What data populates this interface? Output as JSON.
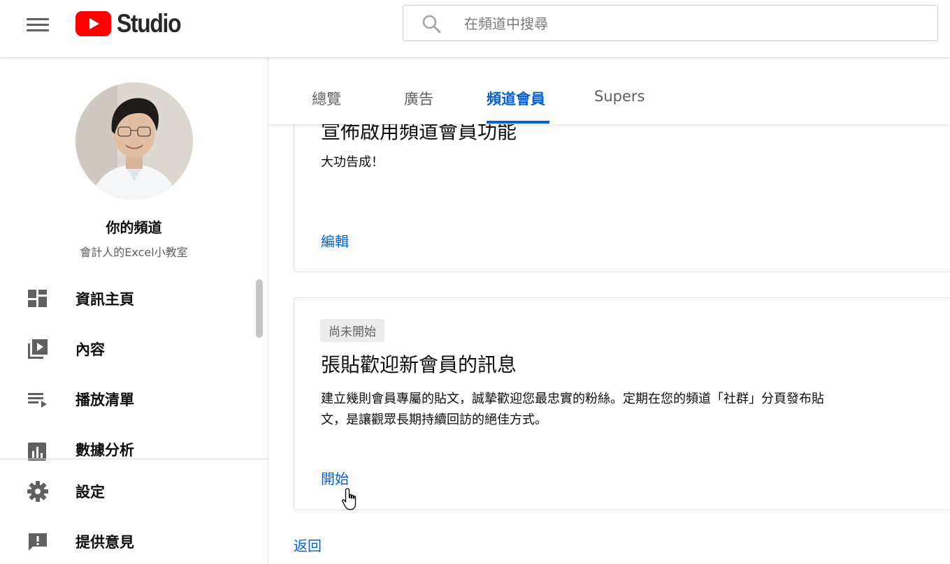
{
  "header": {
    "logo_text": "Studio",
    "search_placeholder": "在頻道中搜尋",
    "brand_color": "#ff0000"
  },
  "sidebar": {
    "channel_title": "你的頻道",
    "channel_name": "會計人的Excel小教室",
    "items": [
      {
        "label": "資訊主頁",
        "icon": "dashboard-icon"
      },
      {
        "label": "內容",
        "icon": "video-library-icon"
      },
      {
        "label": "播放清單",
        "icon": "playlist-icon"
      },
      {
        "label": "數據分析",
        "icon": "analytics-icon"
      }
    ],
    "bottom_items": [
      {
        "label": "設定",
        "icon": "gear-icon"
      },
      {
        "label": "提供意見",
        "icon": "feedback-icon"
      }
    ]
  },
  "tabs": [
    {
      "label": "總覽"
    },
    {
      "label": "廣告"
    },
    {
      "label": "頻道會員",
      "active": true
    },
    {
      "label": "Supers"
    }
  ],
  "cards": [
    {
      "title": "宣佈啟用頻道會員功能",
      "text": "大功告成！",
      "link": "編輯"
    },
    {
      "badge": "尚未開始",
      "title": "張貼歡迎新會員的訊息",
      "text_line1": "建立幾則會員專屬的貼文，誠摯歡迎您最忠實的粉絲。定期在您的頻道「社群」分頁發布貼",
      "text_line2": "文，是讓觀眾長期持續回訪的絕佳方式。",
      "link": "開始"
    }
  ],
  "back_link": "返回",
  "colors": {
    "accent": "#065fd4",
    "text": "#0d0d0d",
    "secondary_text": "#606060"
  }
}
